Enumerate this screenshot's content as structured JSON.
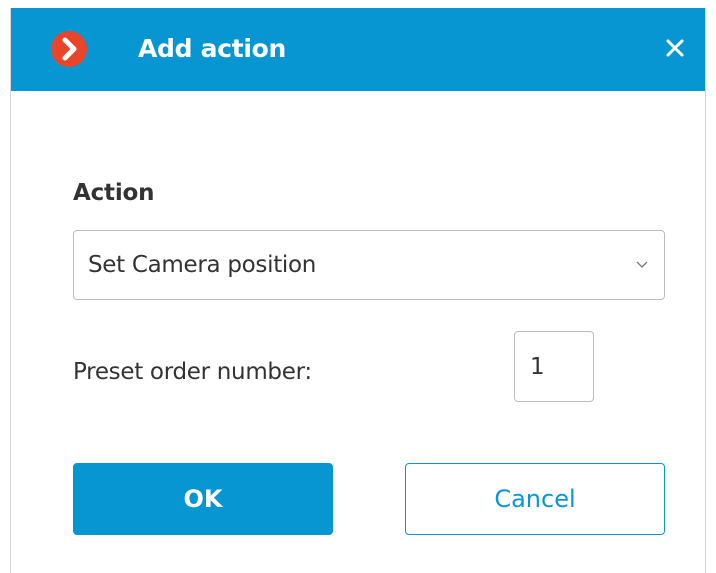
{
  "dialog": {
    "title": "Add action",
    "logo_icon": "chevron-right-circle-icon",
    "close_icon": "close-icon",
    "accent_color": "#0896d3",
    "logo_color": "#e8452b"
  },
  "action": {
    "section_label": "Action",
    "selected_value": "Set Camera position",
    "dropdown_icon": "chevron-down-icon"
  },
  "preset": {
    "label": "Preset order number:",
    "value": "1"
  },
  "buttons": {
    "ok_label": "OK",
    "cancel_label": "Cancel"
  }
}
